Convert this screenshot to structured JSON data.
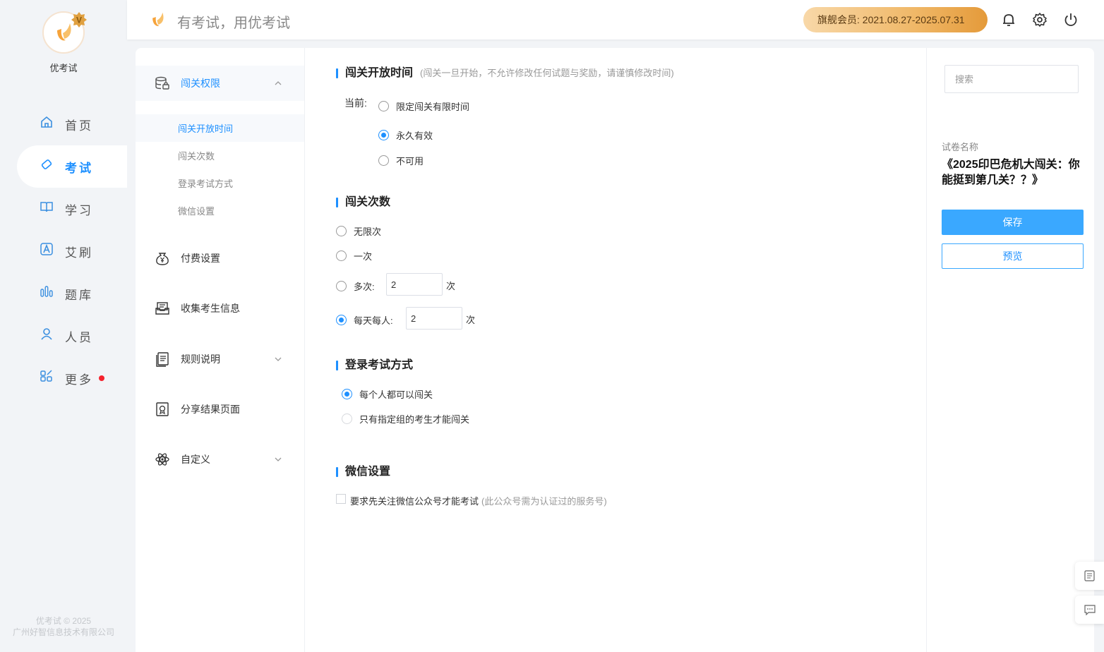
{
  "brand": {
    "name": "优考试",
    "vip_letter": "V"
  },
  "nav": {
    "items": [
      {
        "id": "home",
        "label": "首页",
        "icon": "home-icon"
      },
      {
        "id": "exam",
        "label": "考试",
        "icon": "tag-icon",
        "active": true
      },
      {
        "id": "study",
        "label": "学习",
        "icon": "book-icon"
      },
      {
        "id": "aishua",
        "label": "艾刷",
        "icon": "a-box-icon"
      },
      {
        "id": "bank",
        "label": "题库",
        "icon": "bars-icon"
      },
      {
        "id": "people",
        "label": "人员",
        "icon": "user-icon"
      },
      {
        "id": "more",
        "label": "更多",
        "icon": "grid-icon",
        "badge_dot": true
      }
    ]
  },
  "copyright": {
    "line1": "优考试 © 2025",
    "line2": "广州好智信息技术有限公司"
  },
  "header": {
    "slogan": "有考试，用优考试",
    "membership": "旗舰会员:  2021.08.27-2025.07.31"
  },
  "submenu": {
    "groups": [
      {
        "label": "闯关权限",
        "icon": "database-lock-icon",
        "open": true,
        "children": [
          "闯关开放时间",
          "闯关次数",
          "登录考试方式",
          "微信设置"
        ]
      },
      {
        "label": "付费设置",
        "icon": "money-bag-icon"
      },
      {
        "label": "收集考生信息",
        "icon": "inbox-icon"
      },
      {
        "label": "规则说明",
        "icon": "document-icon",
        "expandable": true
      },
      {
        "label": "分享结果页面",
        "icon": "certificate-icon"
      },
      {
        "label": "自定义",
        "icon": "atom-icon",
        "expandable": true
      }
    ]
  },
  "sections": {
    "open_time": {
      "title": "闯关开放时间",
      "note": "(闯关一旦开始，不允许修改任何试题与奖励，请谨慎修改时间)",
      "current_label": "当前:",
      "options": [
        "限定闯关有限时间",
        "永久有效",
        "不可用"
      ],
      "selected_index": 1
    },
    "attempts": {
      "title": "闯关次数",
      "options": [
        "无限次",
        "一次",
        "多次:",
        "每天每人:"
      ],
      "multi_value": "2",
      "daily_value": "2",
      "unit": "次",
      "selected_index": 3
    },
    "login": {
      "title": "登录考试方式",
      "options": [
        "每个人都可以闯关",
        "只有指定组的考生才能闯关"
      ],
      "selected_index": 0
    },
    "wechat": {
      "title": "微信设置",
      "checkbox_label": "要求先关注微信公众号才能考试",
      "checkbox_note": "(此公众号需为认证过的服务号)",
      "checked": false
    }
  },
  "right_panel": {
    "search_placeholder": "搜索",
    "paper_label": "试卷名称",
    "paper_name": "《2025印巴危机大闯关：你能挺到第几关？？》",
    "save_label": "保存",
    "preview_label": "预览"
  },
  "colors": {
    "accent": "#1e90ff",
    "save_bg": "#3aa8ff",
    "badge": "#f5222d",
    "vip_gold": "#f0b868"
  }
}
